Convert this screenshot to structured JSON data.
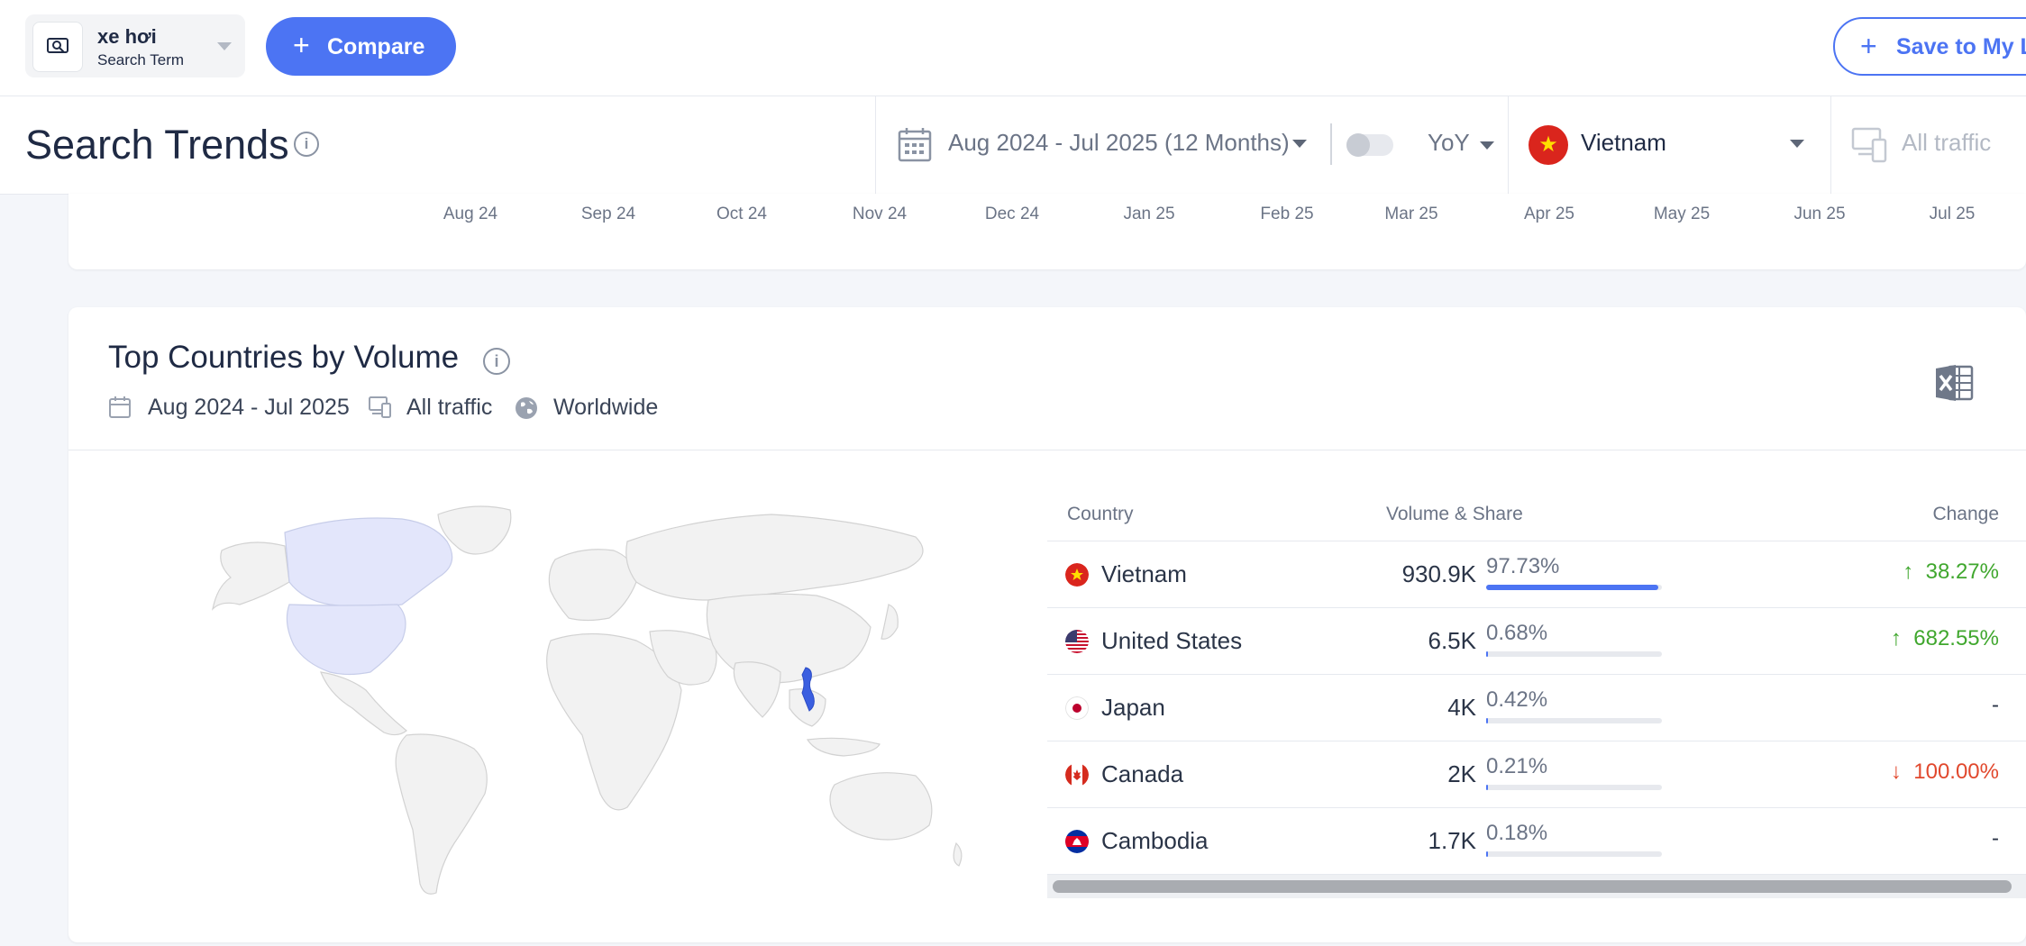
{
  "search": {
    "term": "xe hơi",
    "type_label": "Search Term"
  },
  "toolbar": {
    "compare_label": "Compare",
    "save_label": "Save to My L"
  },
  "header": {
    "title": "Search Trends",
    "date_range": "Aug 2024 - Jul 2025 (12 Months)",
    "comparison": "YoY",
    "country": "Vietnam",
    "traffic": "All traffic"
  },
  "chart_axis": {
    "months": [
      "Aug 24",
      "Sep 24",
      "Oct 24",
      "Nov 24",
      "Dec 24",
      "Jan 25",
      "Feb 25",
      "Mar 25",
      "Apr 25",
      "May 25",
      "Jun 25",
      "Jul 25"
    ]
  },
  "top_countries": {
    "title": "Top Countries by Volume",
    "date_range": "Aug 2024 - Jul 2025",
    "traffic": "All traffic",
    "region": "Worldwide",
    "columns": {
      "country": "Country",
      "volume_share": "Volume & Share",
      "change": "Change"
    },
    "rows": [
      {
        "country": "Vietnam",
        "volume": "930.9K",
        "share": "97.73%",
        "share_value": 97.73,
        "change": "38.27%",
        "direction": "up"
      },
      {
        "country": "United States",
        "volume": "6.5K",
        "share": "0.68%",
        "share_value": 0.68,
        "change": "682.55%",
        "direction": "up"
      },
      {
        "country": "Japan",
        "volume": "4K",
        "share": "0.42%",
        "share_value": 0.42,
        "change": "-",
        "direction": "none"
      },
      {
        "country": "Canada",
        "volume": "2K",
        "share": "0.21%",
        "share_value": 0.21,
        "change": "100.00%",
        "direction": "down"
      },
      {
        "country": "Cambodia",
        "volume": "1.7K",
        "share": "0.18%",
        "share_value": 0.18,
        "change": "-",
        "direction": "none"
      }
    ]
  },
  "colors": {
    "accent": "#4c74f3",
    "positive": "#40a72e",
    "negative": "#e1482d",
    "map_highlight": "#e3e6fb"
  }
}
